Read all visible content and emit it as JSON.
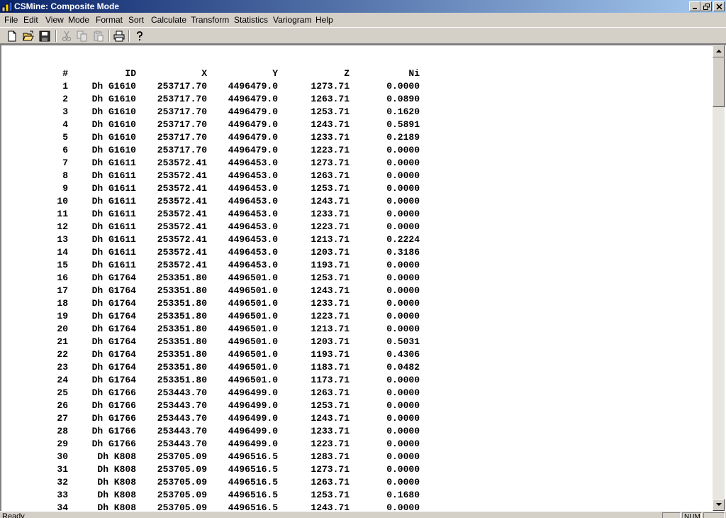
{
  "window": {
    "title": "CSMine: Composite Mode",
    "app_icon": "csmine-app-icon",
    "controls": [
      "minimize-icon",
      "restore-icon",
      "close-icon"
    ]
  },
  "menu": {
    "items": [
      "File",
      "Edit",
      "View",
      "Mode",
      "Format",
      "Sort",
      "Calculate",
      "Transform",
      "Statistics",
      "Variogram",
      "Help"
    ]
  },
  "toolbar": {
    "buttons": [
      "new-file-icon",
      "open-folder-icon",
      "save-disk-icon",
      "cut-scissors-icon",
      "copy-icon",
      "paste-clipboard-icon",
      "print-icon",
      "help-question-icon"
    ],
    "disabled": [
      "cut-scissors-icon",
      "copy-icon",
      "paste-clipboard-icon"
    ]
  },
  "table": {
    "headers": [
      "#",
      "ID",
      "X",
      "Y",
      "Z",
      "Ni"
    ],
    "rows": [
      [
        "1",
        "Dh G1610",
        "253717.70",
        "4496479.0",
        "1273.71",
        "0.0000"
      ],
      [
        "2",
        "Dh G1610",
        "253717.70",
        "4496479.0",
        "1263.71",
        "0.0890"
      ],
      [
        "3",
        "Dh G1610",
        "253717.70",
        "4496479.0",
        "1253.71",
        "0.1620"
      ],
      [
        "4",
        "Dh G1610",
        "253717.70",
        "4496479.0",
        "1243.71",
        "0.5891"
      ],
      [
        "5",
        "Dh G1610",
        "253717.70",
        "4496479.0",
        "1233.71",
        "0.2189"
      ],
      [
        "6",
        "Dh G1610",
        "253717.70",
        "4496479.0",
        "1223.71",
        "0.0000"
      ],
      [
        "7",
        "Dh G1611",
        "253572.41",
        "4496453.0",
        "1273.71",
        "0.0000"
      ],
      [
        "8",
        "Dh G1611",
        "253572.41",
        "4496453.0",
        "1263.71",
        "0.0000"
      ],
      [
        "9",
        "Dh G1611",
        "253572.41",
        "4496453.0",
        "1253.71",
        "0.0000"
      ],
      [
        "10",
        "Dh G1611",
        "253572.41",
        "4496453.0",
        "1243.71",
        "0.0000"
      ],
      [
        "11",
        "Dh G1611",
        "253572.41",
        "4496453.0",
        "1233.71",
        "0.0000"
      ],
      [
        "12",
        "Dh G1611",
        "253572.41",
        "4496453.0",
        "1223.71",
        "0.0000"
      ],
      [
        "13",
        "Dh G1611",
        "253572.41",
        "4496453.0",
        "1213.71",
        "0.2224"
      ],
      [
        "14",
        "Dh G1611",
        "253572.41",
        "4496453.0",
        "1203.71",
        "0.3186"
      ],
      [
        "15",
        "Dh G1611",
        "253572.41",
        "4496453.0",
        "1193.71",
        "0.0000"
      ],
      [
        "16",
        "Dh G1764",
        "253351.80",
        "4496501.0",
        "1253.71",
        "0.0000"
      ],
      [
        "17",
        "Dh G1764",
        "253351.80",
        "4496501.0",
        "1243.71",
        "0.0000"
      ],
      [
        "18",
        "Dh G1764",
        "253351.80",
        "4496501.0",
        "1233.71",
        "0.0000"
      ],
      [
        "19",
        "Dh G1764",
        "253351.80",
        "4496501.0",
        "1223.71",
        "0.0000"
      ],
      [
        "20",
        "Dh G1764",
        "253351.80",
        "4496501.0",
        "1213.71",
        "0.0000"
      ],
      [
        "21",
        "Dh G1764",
        "253351.80",
        "4496501.0",
        "1203.71",
        "0.5031"
      ],
      [
        "22",
        "Dh G1764",
        "253351.80",
        "4496501.0",
        "1193.71",
        "0.4306"
      ],
      [
        "23",
        "Dh G1764",
        "253351.80",
        "4496501.0",
        "1183.71",
        "0.0482"
      ],
      [
        "24",
        "Dh G1764",
        "253351.80",
        "4496501.0",
        "1173.71",
        "0.0000"
      ],
      [
        "25",
        "Dh G1766",
        "253443.70",
        "4496499.0",
        "1263.71",
        "0.0000"
      ],
      [
        "26",
        "Dh G1766",
        "253443.70",
        "4496499.0",
        "1253.71",
        "0.0000"
      ],
      [
        "27",
        "Dh G1766",
        "253443.70",
        "4496499.0",
        "1243.71",
        "0.0000"
      ],
      [
        "28",
        "Dh G1766",
        "253443.70",
        "4496499.0",
        "1233.71",
        "0.0000"
      ],
      [
        "29",
        "Dh G1766",
        "253443.70",
        "4496499.0",
        "1223.71",
        "0.0000"
      ],
      [
        "30",
        "Dh K808",
        "253705.09",
        "4496516.5",
        "1283.71",
        "0.0000"
      ],
      [
        "31",
        "Dh K808",
        "253705.09",
        "4496516.5",
        "1273.71",
        "0.0000"
      ],
      [
        "32",
        "Dh K808",
        "253705.09",
        "4496516.5",
        "1263.71",
        "0.0000"
      ],
      [
        "33",
        "Dh K808",
        "253705.09",
        "4496516.5",
        "1253.71",
        "0.1680"
      ],
      [
        "34",
        "Dh K808",
        "253705.09",
        "4496516.5",
        "1243.71",
        "0.0000"
      ]
    ]
  },
  "statusbar": {
    "text": "Ready",
    "panes": [
      "",
      "NUM",
      ""
    ]
  },
  "scrollbar": {
    "icons": [
      "scroll-up-arrow-icon",
      "scroll-down-arrow-icon"
    ]
  }
}
